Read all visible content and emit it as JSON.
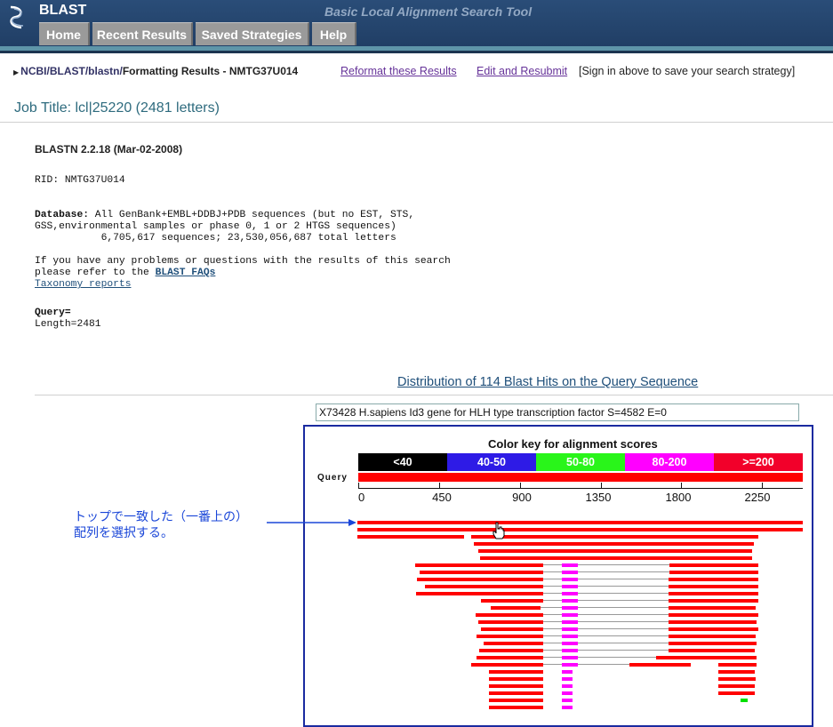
{
  "header": {
    "app_name": "BLAST",
    "subtitle": "Basic Local Alignment Search Tool",
    "tabs": [
      {
        "label": "Home"
      },
      {
        "label": "Recent Results"
      },
      {
        "label": "Saved Strategies"
      },
      {
        "label": "Help"
      }
    ]
  },
  "breadcrumb": {
    "items": [
      "NCBI/",
      "BLAST/",
      "blastn/"
    ],
    "current": "Formatting Results - NMTG37U014"
  },
  "links": {
    "reformat": "Reformat these Results",
    "edit": "Edit and Resubmit",
    "sign_in_note": "[Sign in above to save your search strategy]"
  },
  "job_title": "Job Title: lcl|25220 (2481 letters)",
  "report": {
    "version": "BLASTN 2.2.18 (Mar-02-2008)",
    "rid": "RID: NMTG37U014",
    "database_label": "Database:",
    "database_line1": " All GenBank+EMBL+DDBJ+PDB sequences (but no EST, STS,",
    "database_line2": "GSS,environmental samples or phase 0, 1 or 2 HTGS sequences)",
    "database_line3": "           6,705,617 sequences; 23,530,056,687 total letters",
    "help_line1": "If you have any problems or questions with the results of this search",
    "help_line2": "please refer to the ",
    "faq_link": "BLAST FAQs",
    "taxonomy_link": "Taxonomy reports",
    "query_label": "Query=",
    "length": "Length=2481"
  },
  "distribution": {
    "title": "Distribution of 114 Blast Hits on the Query Sequence",
    "hit_description": "X73428 H.sapiens Id3 gene for HLH type transcription factor S=4582 E=0",
    "color_key_title": "Color key for alignment scores",
    "color_key": [
      {
        "label": "<40",
        "color": "#000000"
      },
      {
        "label": "40-50",
        "color": "#2e1be6"
      },
      {
        "label": "50-80",
        "color": "#29f51a"
      },
      {
        "label": "80-200",
        "color": "#ff00ff"
      },
      {
        "label": ">=200",
        "color": "#f2002a"
      }
    ],
    "query_label": "Query",
    "query_length": 2481,
    "ticks": [
      "0",
      "450",
      "900",
      "1350",
      "1800",
      "2250"
    ],
    "hit_colors": {
      "red": "#ff0000",
      "magenta": "#ff00ff",
      "green": "#00e000",
      "gap": "#999999"
    }
  },
  "annotation": {
    "line1": "トップで一致した（一番上の）",
    "line2": "配列を選択する。"
  }
}
